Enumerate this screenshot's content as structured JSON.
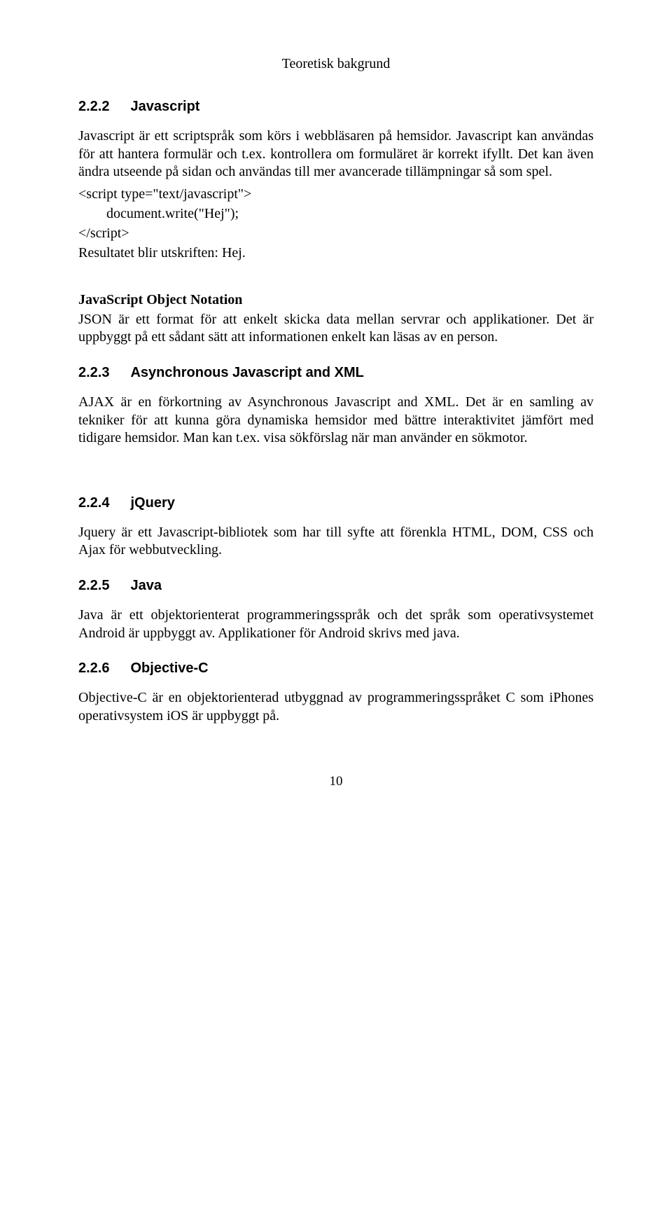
{
  "header": {
    "title": "Teoretisk bakgrund"
  },
  "sections": {
    "javascript": {
      "num": "2.2.2",
      "title": "Javascript",
      "p1": "Javascript är ett scriptspråk som körs i webbläsaren på hemsidor. Javascript kan användas för att hantera formulär och t.ex. kontrollera om formuläret är korrekt ifyllt. Det kan även ändra utseende på sidan och användas till mer avancerade tillämpningar så som spel.",
      "code": {
        "l1": "<script type=\"text/javascript\">",
        "l2": "document.write(\"Hej\");",
        "l3": "</script>"
      },
      "result": "Resultatet blir utskriften: Hej.",
      "jsonHeading": "JavaScript Object Notation",
      "jsonBody": "JSON är ett format för att enkelt skicka data mellan servrar och applikationer. Det är uppbyggt på ett sådant sätt att informationen enkelt kan läsas av en person."
    },
    "ajax": {
      "num": "2.2.3",
      "title": "Asynchronous Javascript and XML",
      "p1": "AJAX är en förkortning av Asynchronous Javascript and XML. Det är en samling av tekniker för att kunna göra dynamiska hemsidor med bättre interaktivitet jämfört med tidigare hemsidor. Man kan t.ex. visa sökförslag när man använder en sökmotor."
    },
    "jquery": {
      "num": "2.2.4",
      "title": "jQuery",
      "p1": "Jquery är ett Javascript-bibliotek som har till syfte att förenkla HTML, DOM, CSS och Ajax för webbutveckling."
    },
    "java": {
      "num": "2.2.5",
      "title": "Java",
      "p1": "Java är ett objektorienterat programmeringsspråk och det språk som operativsystemet Android är uppbyggt av. Applikationer för Android skrivs med java."
    },
    "objectivec": {
      "num": "2.2.6",
      "title": "Objective-C",
      "p1": "Objective-C är en objektorienterad utbyggnad av programmeringsspråket C som iPhones operativsystem iOS är uppbyggt på."
    }
  },
  "pageNumber": "10"
}
